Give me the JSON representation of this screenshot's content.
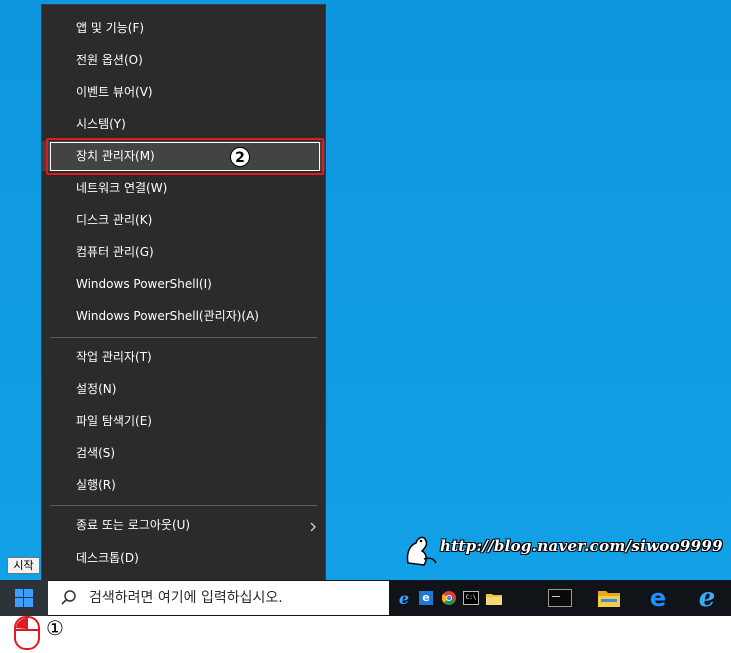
{
  "menu": {
    "items": [
      {
        "label": "앱 및 기능(F)"
      },
      {
        "label": "전원 옵션(O)"
      },
      {
        "label": "이벤트 뷰어(V)"
      },
      {
        "label": "시스템(Y)"
      },
      {
        "label": "장치 관리자(M)"
      },
      {
        "label": "네트워크 연결(W)"
      },
      {
        "label": "디스크 관리(K)"
      },
      {
        "label": "컴퓨터 관리(G)"
      },
      {
        "label": "Windows PowerShell(I)"
      },
      {
        "label": "Windows PowerShell(관리자)(A)"
      },
      {
        "label": "작업 관리자(T)"
      },
      {
        "label": "설정(N)"
      },
      {
        "label": "파일 탐색기(E)"
      },
      {
        "label": "검색(S)"
      },
      {
        "label": "실행(R)"
      },
      {
        "label": "종료 또는 로그아웃(U)"
      },
      {
        "label": "데스크톱(D)"
      }
    ],
    "highlighted_index": 4
  },
  "annotations": {
    "step1": "①",
    "step2": "2"
  },
  "tooltip": "시작",
  "taskbar": {
    "search_placeholder": "검색하려면 여기에 입력하십시오.",
    "icons": [
      "ie-icon",
      "ie-blue-icon",
      "chrome-icon",
      "cmd-icon",
      "folder-icon",
      "cmd-icon",
      "file-explorer-icon",
      "edge-icon",
      "ie-icon"
    ]
  },
  "watermark": "http://blog.naver.com/siwoo9999",
  "colors": {
    "desktop": "#0f9ae0",
    "menu_bg": "#2b2b2b",
    "highlight_border": "#e01a22",
    "taskbar": "#101418"
  }
}
